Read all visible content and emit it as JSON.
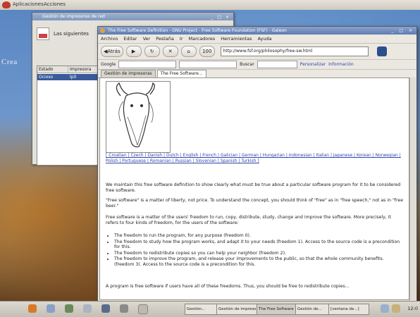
{
  "top_panel": {
    "menus": [
      "Aplicaciones",
      "Acciones"
    ]
  },
  "desktop": {
    "label": "Crea"
  },
  "back_window": {
    "title": "Gestión de impresoras de red",
    "header_text": "Las siguientes",
    "columns": [
      "Estado",
      "Impresora"
    ],
    "row": [
      "Ocioso",
      "lp0"
    ]
  },
  "browser": {
    "title": "The Free Software Definition - GNU Project - Free Software Foundation (FSF) - Galeon",
    "menus": [
      "Archivo",
      "Editar",
      "Ver",
      "Pestaña",
      "Ir",
      "Marcadores",
      "Herramientas",
      "Ayuda"
    ],
    "nav": {
      "back": "Atrás",
      "forward": "",
      "reload": "",
      "stop": "",
      "zoom": "100"
    },
    "url": "http://www.fsf.org/philosophy/free-sw.html",
    "search": {
      "google_label": "Google",
      "find_label": "Buscar",
      "links": [
        "Personalizar",
        "Información"
      ]
    },
    "tabs": [
      "Gestión de impresoras",
      "The Free Software..."
    ],
    "active_tab": 1,
    "languages_text": "[ Croatian | Czech | Danish | Dutch | English | French | Galician | German | Hungarian | Indonesian | Italian | Japanese | Korean | Norwegian | Polish | Portuguese | Romanian | Russian | Slovenian | Spanish | Turkish ]",
    "intro": "We maintain this free software definition to show clearly what must be true about a particular software program for it to be considered free software.",
    "free_speech": "\"Free software\" is a matter of liberty, not price. To understand the concept, you should think of \"free\" as in \"free speech,\" not as in \"free beer.\"",
    "freedom_intro": "Free software is a matter of the users' freedom to run, copy, distribute, study, change and improve the software. More precisely, it refers to four kinds of freedom, for the users of the software:",
    "freedoms": [
      "The freedom to run the program, for any purpose (freedom 0).",
      "The freedom to study how the program works, and adapt it to your needs (freedom 1). Access to the source code is a precondition for this.",
      "The freedom to redistribute copies so you can help your neighbor (freedom 2).",
      "The freedom to improve the program, and release your improvements to the public, so that the whole community benefits. (freedom 3). Access to the source code is a precondition for this."
    ],
    "outro": "A program is free software if users have all of these freedoms. Thus, you should be free to redistribute copies..."
  },
  "taskbar": {
    "tasks": [
      "Gestión...",
      "Gestión de impresoras",
      "The Free Software",
      "Gestión de...",
      "[ventana de...]"
    ],
    "clock": "12:0"
  }
}
